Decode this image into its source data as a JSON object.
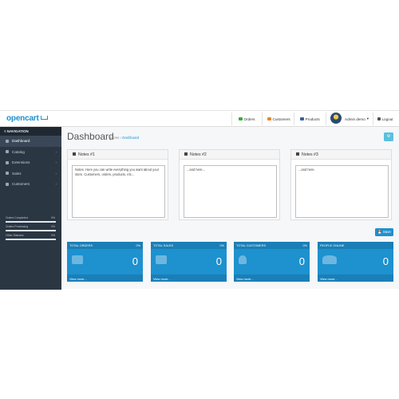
{
  "header": {
    "logo": "opencart",
    "orders": "Orders",
    "customers": "Customers",
    "products": "Products",
    "user": "Admin demo",
    "logout": "Logout"
  },
  "sidebar": {
    "heading": "NAVIGATION",
    "items": [
      {
        "label": "Dashboard"
      },
      {
        "label": "Catalog"
      },
      {
        "label": "Extensions"
      },
      {
        "label": "Sales"
      },
      {
        "label": "Customers"
      }
    ],
    "stats": [
      {
        "label": "Orders Completed",
        "percent": "0%",
        "value": 0
      },
      {
        "label": "Orders Processing",
        "percent": "0%",
        "value": 0
      },
      {
        "label": "Other Statuses",
        "percent": "0%",
        "value": 0
      }
    ]
  },
  "page": {
    "title": "Dashboard",
    "breadcrumb_home": "Home",
    "breadcrumb_current": "Dashboard"
  },
  "notes": [
    {
      "title": "Notes #1",
      "text": "Notes. Here you can write everything you want about your store. Customers, orders, products, etc..."
    },
    {
      "title": "Notes #2",
      "text": "...and here..."
    },
    {
      "title": "Notes #3",
      "text": "...and here."
    }
  ],
  "save_label": "Save",
  "tiles": [
    {
      "title": "TOTAL ORDERS",
      "percent": "0%",
      "value": "0",
      "link": "View more..."
    },
    {
      "title": "TOTAL SALES",
      "percent": "0%",
      "value": "0",
      "link": "View more..."
    },
    {
      "title": "TOTAL CUSTOMERS",
      "percent": "0%",
      "value": "0",
      "link": "View more..."
    },
    {
      "title": "PEOPLE ONLINE",
      "percent": "",
      "value": "0",
      "link": "View more..."
    }
  ],
  "colors": {
    "accent": "#1e91cf",
    "sidebar": "#2b3643",
    "info": "#5bc0de"
  }
}
